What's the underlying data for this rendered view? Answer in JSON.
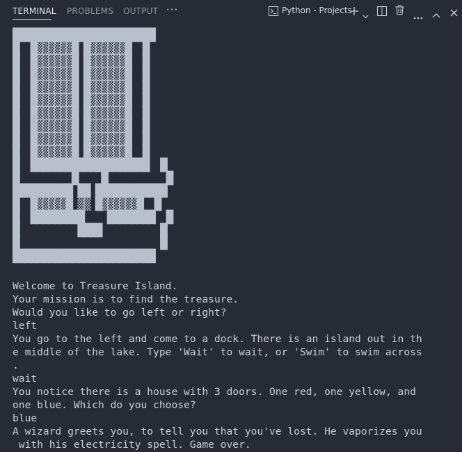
{
  "panel": {
    "tabs": [
      {
        "label": "TERMINAL",
        "active": true
      },
      {
        "label": "PROBLEMS",
        "active": false
      },
      {
        "label": "OUTPUT",
        "active": false
      }
    ],
    "more_label": "···",
    "terminal_name": "Python - Projects",
    "icons": [
      "terminal-icon",
      "plus-icon",
      "chevron-down-icon",
      "split-icon",
      "trash-icon",
      "ellipsis-icon",
      "chevron-up-icon",
      "close-icon"
    ],
    "accent_color": "#e6e8ec"
  },
  "ascii_art": [
    "████████████████████████",
    "█  █▒▒▒▒▒▒█ █▒▒▒▒▒▒█  █",
    "█  █▒▒▒▒▒▒█ █▒▒▒▒▒▒█  █",
    "█  █▒▒▒▒▒▒█ █▒▒▒▒▒▒█  █",
    "█  █▒▒▒▒▒▒█ █▒▒▒▒▒▒█  █",
    "█  █▒▒▒▒▒▒█ █▒▒▒▒▒▒█  █",
    "█  █▒▒▒▒▒▒█ █▒▒▒▒▒▒█  █",
    "█  █▒▒▒▒▒▒█ █▒▒▒▒▒▒█  █",
    "█  █▒▒▒▒▒▒█ █▒▒▒▒▒▒█  █",
    "█  █▒▒▒▒▒▒█ █▒▒▒▒▒▒█  █",
    "█  ████████████████████  █",
    "█         █    █          █",
    "██████████ ██ ████████████",
    "█  █▒▒▒▒▒█ ▒▒ █▒▒▒▒▒▒█  █",
    "█  █████████    ████████  █",
    "█          ████          █",
    "█                        █",
    "████████████████████████"
  ],
  "terminal_output": [
    "Welcome to Treasure Island.",
    "Your mission is to find the treasure.",
    "Would you like to go left or right?",
    "left",
    "You go to the left and come to a dock. There is an island out in th",
    "e middle of the lake. Type 'Wait' to wait, or 'Swim' to swim across",
    ".",
    "wait",
    "You notice there is a house with 3 doors. One red, one yellow, and",
    "one blue. Which do you choose?",
    "blue",
    "A wizard greets you, to tell you that you've lost. He vaporizes you",
    " with his electricity spell. Game over."
  ]
}
